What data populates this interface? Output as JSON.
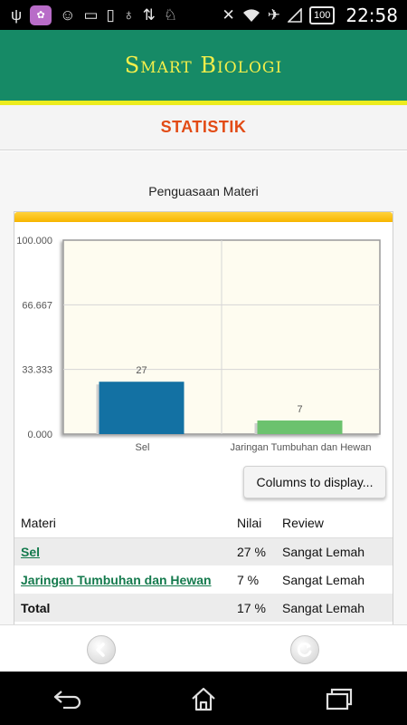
{
  "status_bar": {
    "icons": [
      "usb-icon",
      "app-icon",
      "cat-icon",
      "storage-icon",
      "phone-icon",
      "bulb-icon",
      "data-icon",
      "android-icon",
      "mute-icon",
      "wifi-icon",
      "airplane-icon",
      "signal-icon",
      "battery-icon"
    ],
    "battery": "100",
    "time": "22:58"
  },
  "app": {
    "title": "Smart Biologi",
    "accent": "#168a66",
    "title_color": "#f5ef4a"
  },
  "page": {
    "title": "STATISTIK",
    "title_color": "#e24b15"
  },
  "chart_data": {
    "type": "bar",
    "title": "Penguasaan Materi",
    "categories": [
      "Sel",
      "Jaringan Tumbuhan dan Hewan"
    ],
    "values": [
      27,
      7
    ],
    "data_labels": [
      "27",
      "7"
    ],
    "colors": [
      "#1371a3",
      "#6cc26e"
    ],
    "ylim": [
      0,
      100
    ],
    "yticks": [
      "0.000",
      "33.333",
      "66.667",
      "100.000"
    ],
    "grid": true
  },
  "columns_button": {
    "label": "Columns to display..."
  },
  "table": {
    "headers": {
      "materi": "Materi",
      "nilai": "Nilai",
      "review": "Review"
    },
    "rows": [
      {
        "materi": "Sel",
        "nilai": "27 %",
        "review": "Sangat Lemah"
      },
      {
        "materi": "Jaringan Tumbuhan dan Hewan",
        "nilai": "7 %",
        "review": "Sangat Lemah"
      }
    ],
    "total": {
      "materi": "Total",
      "nilai": "17 %",
      "review": "Sangat Lemah"
    }
  },
  "bottom_bar": {
    "icons": [
      "back-arrow-icon",
      "refresh-icon"
    ]
  },
  "nav_bar": {
    "icons": [
      "back-icon",
      "home-icon",
      "recents-icon"
    ]
  }
}
